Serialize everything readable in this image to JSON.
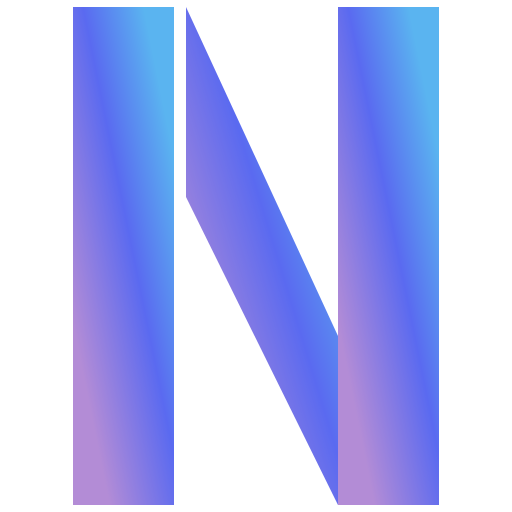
{
  "logo": {
    "letter": "N",
    "icon": "n-letter-logo-icon",
    "colors": {
      "background": "#ffffff",
      "gradient_stop_1": "#b38cd6",
      "gradient_stop_2": "#5a6af0",
      "gradient_stop_3": "#5ab4f0"
    }
  }
}
